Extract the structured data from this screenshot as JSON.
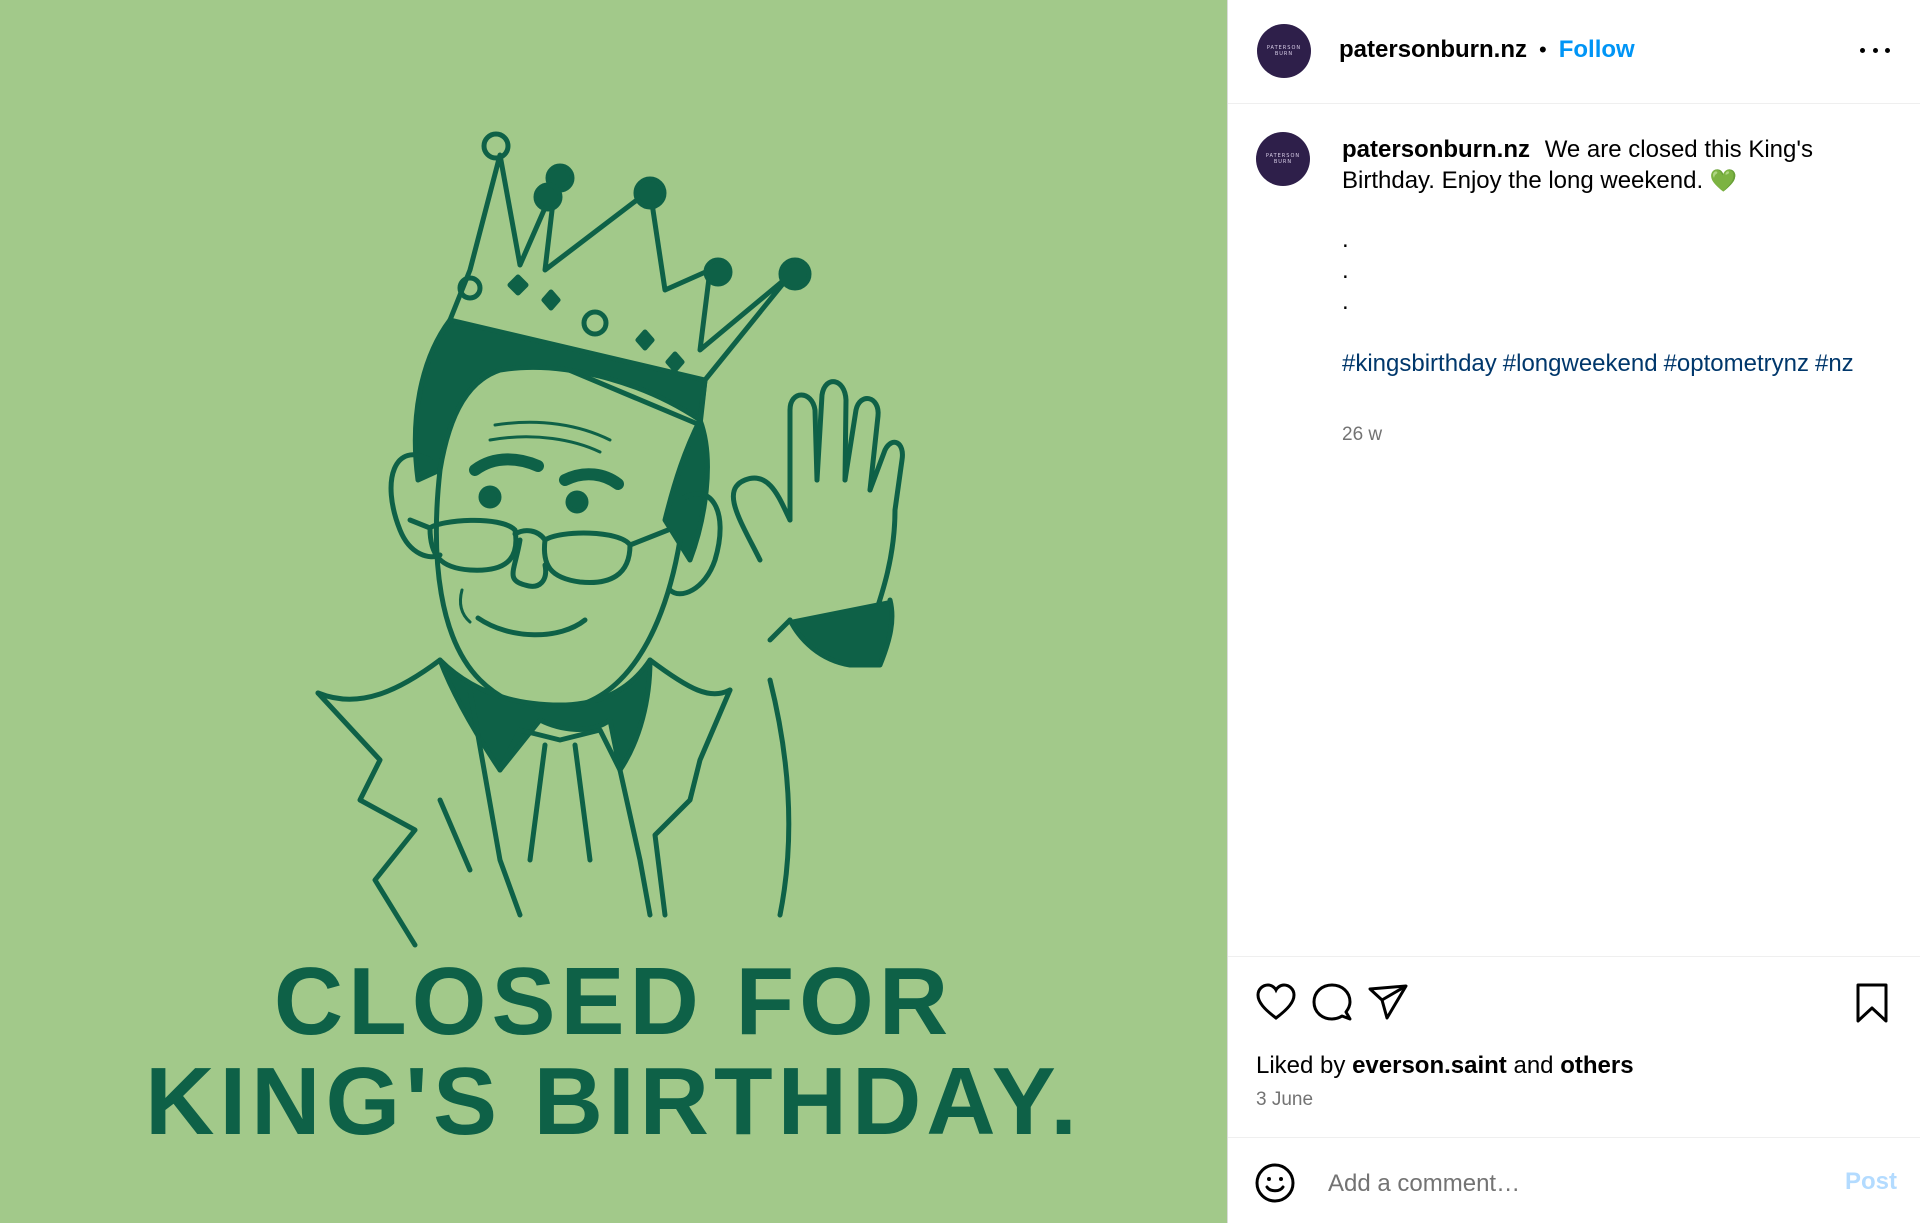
{
  "post": {
    "image": {
      "headline_line1": "CLOSED FOR",
      "headline_line2": "KING'S BIRTHDAY.",
      "background_color": "#a2c98a",
      "ink_color": "#0e6147"
    },
    "header": {
      "avatar_line1": "PATERSON",
      "avatar_line2": "BURN",
      "username": "patersonburn.nz",
      "separator": "•",
      "follow_label": "Follow",
      "more_icon": "more-horizontal-icon"
    },
    "caption": {
      "username": "patersonburn.nz",
      "text": "We are closed this King's Birthday. Enjoy the long weekend.",
      "emoji": "💚",
      "dot_lines": [
        ".",
        ".",
        "."
      ],
      "hashtags": [
        "#kingsbirthday",
        "#longweekend",
        "#optometrynz",
        "#nz"
      ],
      "age": "26 w"
    },
    "actions": {
      "like_icon": "heart-icon",
      "comment_icon": "comment-icon",
      "share_icon": "share-icon",
      "save_icon": "bookmark-icon"
    },
    "likes": {
      "prefix": "Liked by",
      "user": "everson.saint",
      "joiner": "and",
      "others": "others"
    },
    "date": "3 June",
    "comment": {
      "emoji_icon": "smiley-icon",
      "placeholder": "Add a comment…",
      "value": "",
      "post_label": "Post"
    },
    "colors": {
      "link_blue": "#0095f6",
      "hashtag_blue": "#00376b",
      "secondary_text": "#737373",
      "post_disabled": "#b3dbff",
      "avatar_bg": "#2e1f4a"
    }
  }
}
